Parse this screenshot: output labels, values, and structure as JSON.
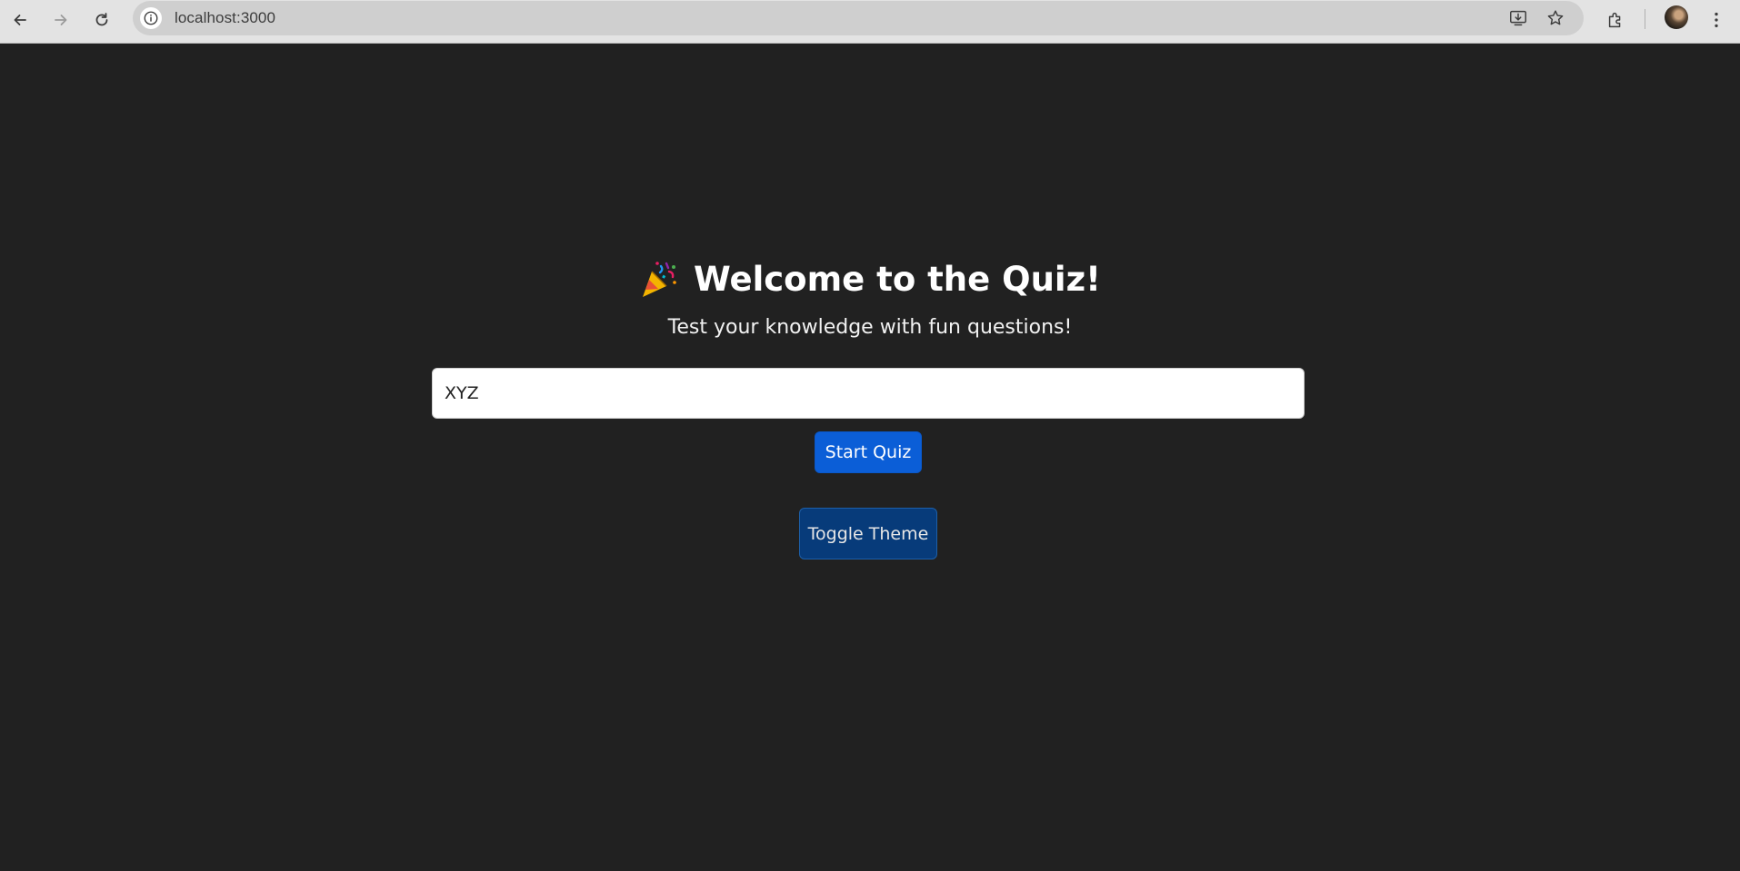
{
  "browser": {
    "url": "localhost:3000"
  },
  "icons": {
    "back": "back-arrow-icon",
    "forward": "forward-arrow-icon",
    "reload": "reload-icon",
    "site_info": "info-icon",
    "install": "install-app-icon",
    "bookmark": "star-icon",
    "extensions": "extensions-icon",
    "menu": "kebab-menu-icon",
    "title": "party-popper-icon"
  },
  "page": {
    "title": "Welcome to the Quiz!",
    "subtitle": "Test your knowledge with fun questions!",
    "name_input_value": "XYZ",
    "start_button": "Start Quiz",
    "toggle_button": "Toggle Theme"
  },
  "colors": {
    "background": "#212121",
    "primary": "#0b5ed7",
    "toggle": "#073b7a"
  }
}
